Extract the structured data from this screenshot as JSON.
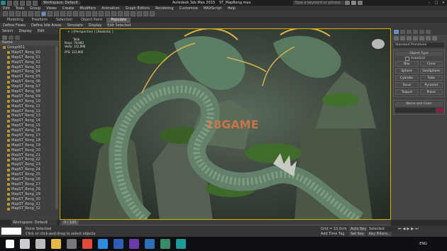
{
  "titlebar": {
    "workspace": "Workspace: Default",
    "app_title": "Autodesk 3ds Max 2015",
    "file_name": "ST_MapRong.max",
    "search_placeholder": "Type a keyword or phrase"
  },
  "menubar": [
    "Edit",
    "Tools",
    "Group",
    "Views",
    "Create",
    "Modifiers",
    "Animation",
    "Graph Editors",
    "Rendering",
    "Customize",
    "MAXScript",
    "Help"
  ],
  "ribbon_tabs": [
    "Modeling",
    "Freeform",
    "Selection",
    "Object Paint",
    "Populate"
  ],
  "ribbon_active": "Populate",
  "populate_row": [
    "Define Flows",
    "Define Idle Areas",
    "Simulate",
    "Display",
    "Edit Selected"
  ],
  "scene_explorer": {
    "tabs": [
      "Select",
      "Display",
      "Edit"
    ],
    "root": "Group001",
    "items": [
      "MapST_Rong_00",
      "MapST_Rong_01",
      "MapST_Rong_02",
      "MapST_Rong_03",
      "MapST_Rong_04",
      "MapST_Rong_05",
      "MapST_Rong_06",
      "MapST_Rong_07",
      "MapST_Rong_08",
      "MapST_Rong_09",
      "MapST_Rong_10",
      "MapST_Rong_11",
      "MapST_Rong_12",
      "MapST_Rong_13",
      "MapST_Rong_14",
      "MapST_Rong_15",
      "MapST_Rong_16",
      "MapST_Rong_17",
      "MapST_Rong_18",
      "MapST_Rong_19",
      "MapST_Rong_20",
      "MapST_Rong_21",
      "MapST_Rong_22",
      "MapST_Rong_23",
      "MapST_Rong_24",
      "MapST_Rong_25",
      "MapST_Rong_26",
      "MapST_Rong_27",
      "MapST_Rong_28",
      "MapST_Rong_29",
      "MapST_Rong_30",
      "MapST_Rong_31",
      "MapST_Rong_32"
    ]
  },
  "viewport": {
    "label": "+ ] [Perspective ] [Realistic ]",
    "stats": {
      "title": "Total",
      "polys_label": "Polys:",
      "polys": "79,983",
      "verts_label": "Verts:",
      "verts": "112,996",
      "fps_label": "FPS:",
      "fps": "112,905"
    }
  },
  "command_panel": {
    "dropdown": "Standard Primitives",
    "rollout_object_type": "Object Type",
    "autogrid": "AutoGrid",
    "buttons": [
      "Box",
      "Cone",
      "Sphere",
      "GeoSphere",
      "Cylinder",
      "Tube",
      "Torus",
      "Pyramid",
      "Teapot",
      "Plane"
    ],
    "rollout_name_color": "Name and Color"
  },
  "bottom": {
    "workspace_label": "Workspace: Default",
    "status_line1": "None Selected",
    "status_line2": "Click or click-and-drag to select objects",
    "timeline_counter": "0 / 100",
    "grid_label": "Grid = 10,0cm",
    "add_time_tag": "Add Time Tag",
    "auto_key": "Auto Key",
    "selected": "Selected",
    "set_key": "Set Key",
    "key_filters": "Key Filters...",
    "ticks": [
      "0",
      "5",
      "10",
      "15",
      "20",
      "25",
      "30",
      "35",
      "40",
      "45",
      "50",
      "55",
      "60",
      "65",
      "70",
      "75",
      "80",
      "85",
      "90",
      "95",
      "100"
    ]
  },
  "taskbar": {
    "lang": "ENG",
    "icons": [
      "windows-icon",
      "search-icon",
      "task-view-icon",
      "file-explorer-icon",
      "calculator-icon",
      "chrome-icon",
      "edge-icon",
      "photoshop-icon",
      "premiere-icon",
      "mail-icon",
      "max-icon",
      "3dsmax-icon"
    ]
  },
  "watermark": "18GAME",
  "colors": {
    "accent": "#2f6fb5",
    "ribbon_active": "#5a5a5a",
    "viewport_border": "#d4b400",
    "color_swatch": "#8a1c3c",
    "taskbar": "#101014"
  }
}
